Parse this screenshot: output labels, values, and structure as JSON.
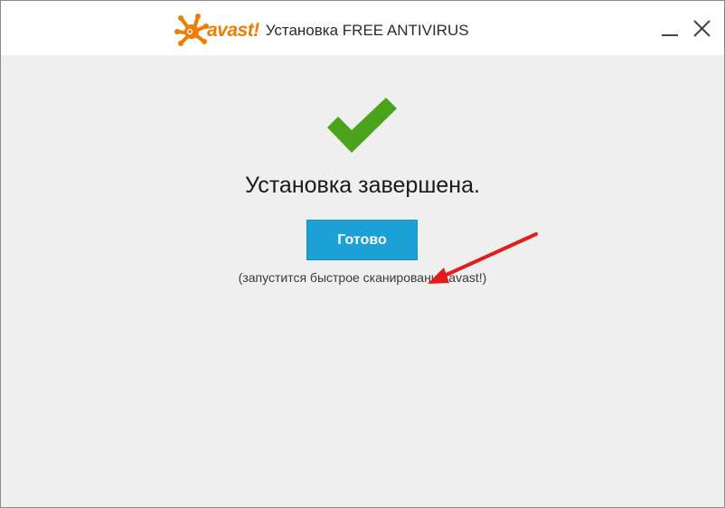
{
  "window": {
    "brand": "avast!",
    "title": "Установка FREE ANTIVIRUS"
  },
  "main": {
    "status_text": "Установка завершена.",
    "done_button_label": "Готово",
    "note": "(запустится быстрое сканирование avast!)"
  },
  "colors": {
    "brand_orange": "#f07c00",
    "check_green": "#4aa31b",
    "button_blue": "#1ba1d6",
    "annotation_arrow_red": "#e31b1b",
    "background": "#efefef"
  },
  "icons": {
    "logo": "avast-logo-icon",
    "minimize": "minimize-icon",
    "close": "close-icon",
    "success": "checkmark-icon",
    "annotation": "red-arrow-icon"
  }
}
